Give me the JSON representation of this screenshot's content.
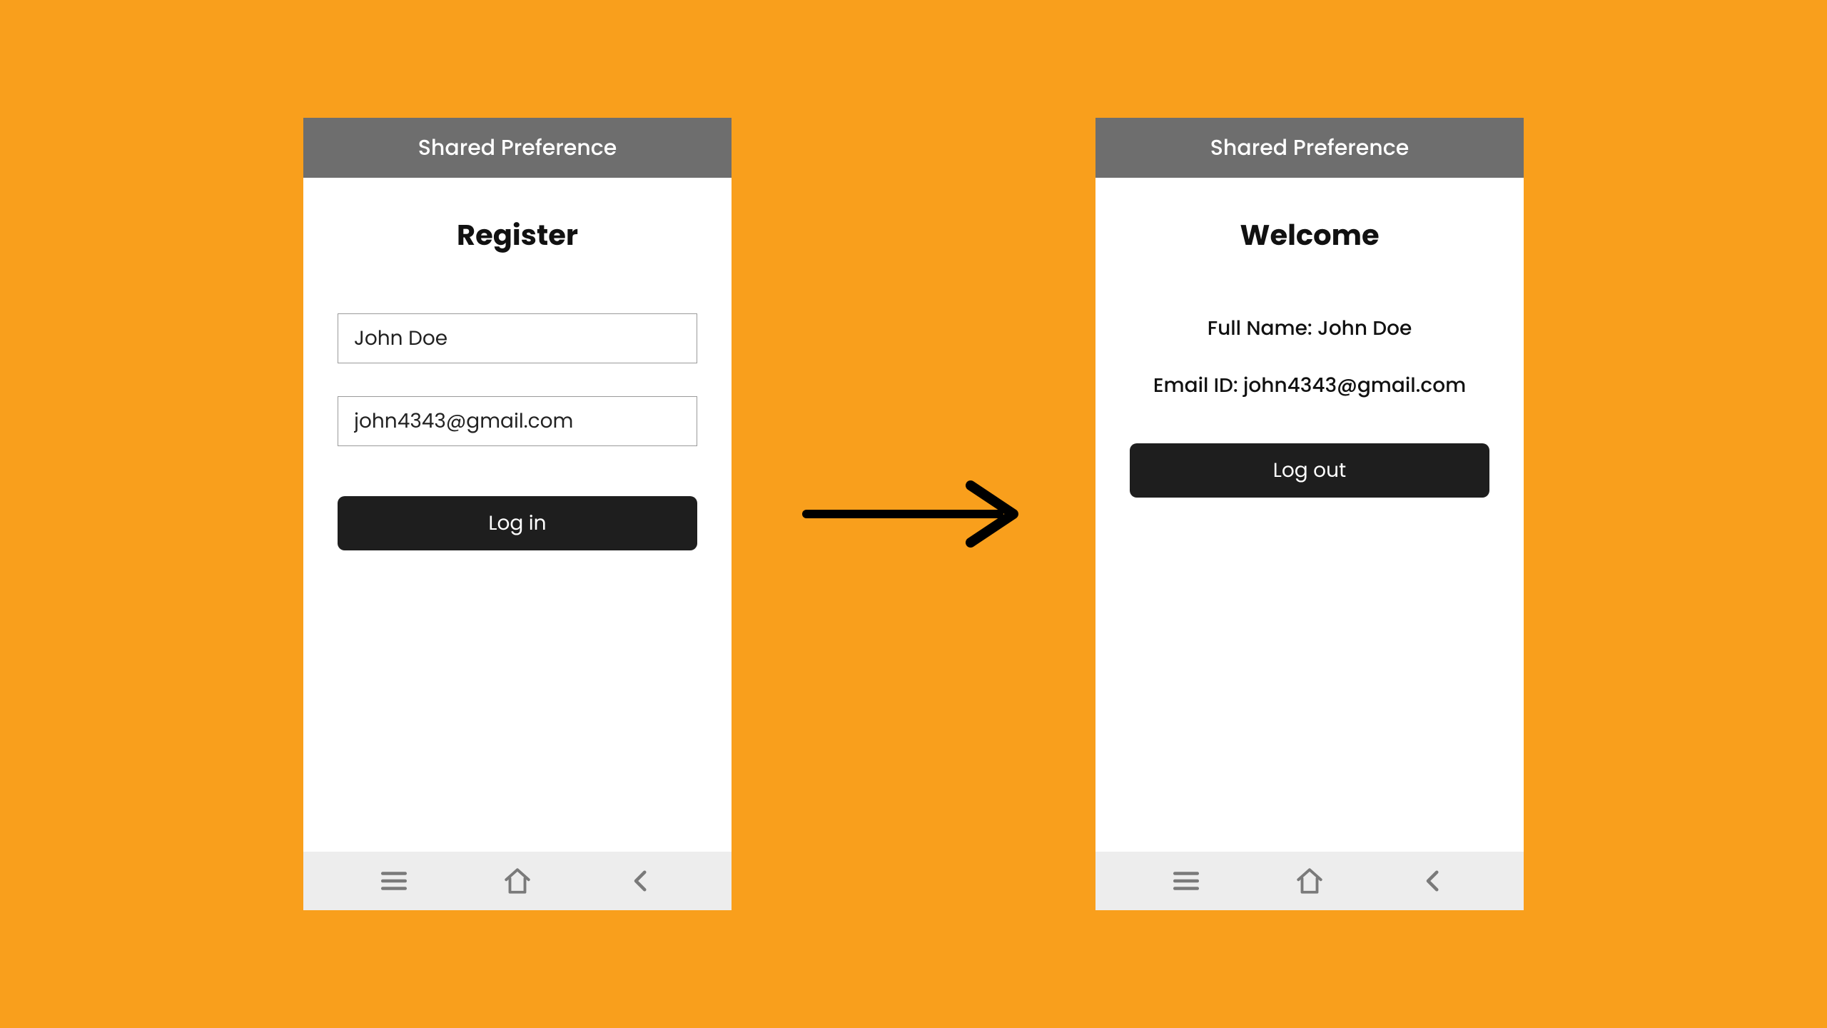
{
  "colors": {
    "background": "#f99f1c",
    "appbar": "#6e6e6e",
    "button": "#1e1e1e",
    "navbar": "#ededed"
  },
  "icons": {
    "menu": "menu-icon",
    "home": "home-icon",
    "back": "back-icon",
    "arrow": "arrow-right-icon"
  },
  "screen_left": {
    "appbar_title": "Shared Preference",
    "page_title": "Register",
    "name_value": "John Doe",
    "email_value": "john4343@gmail.com",
    "button_label": "Log in"
  },
  "screen_right": {
    "appbar_title": "Shared Preference",
    "page_title": "Welcome",
    "fullname_line": "Full Name: John Doe",
    "email_line": "Email ID: john4343@gmail.com",
    "button_label": "Log out"
  }
}
